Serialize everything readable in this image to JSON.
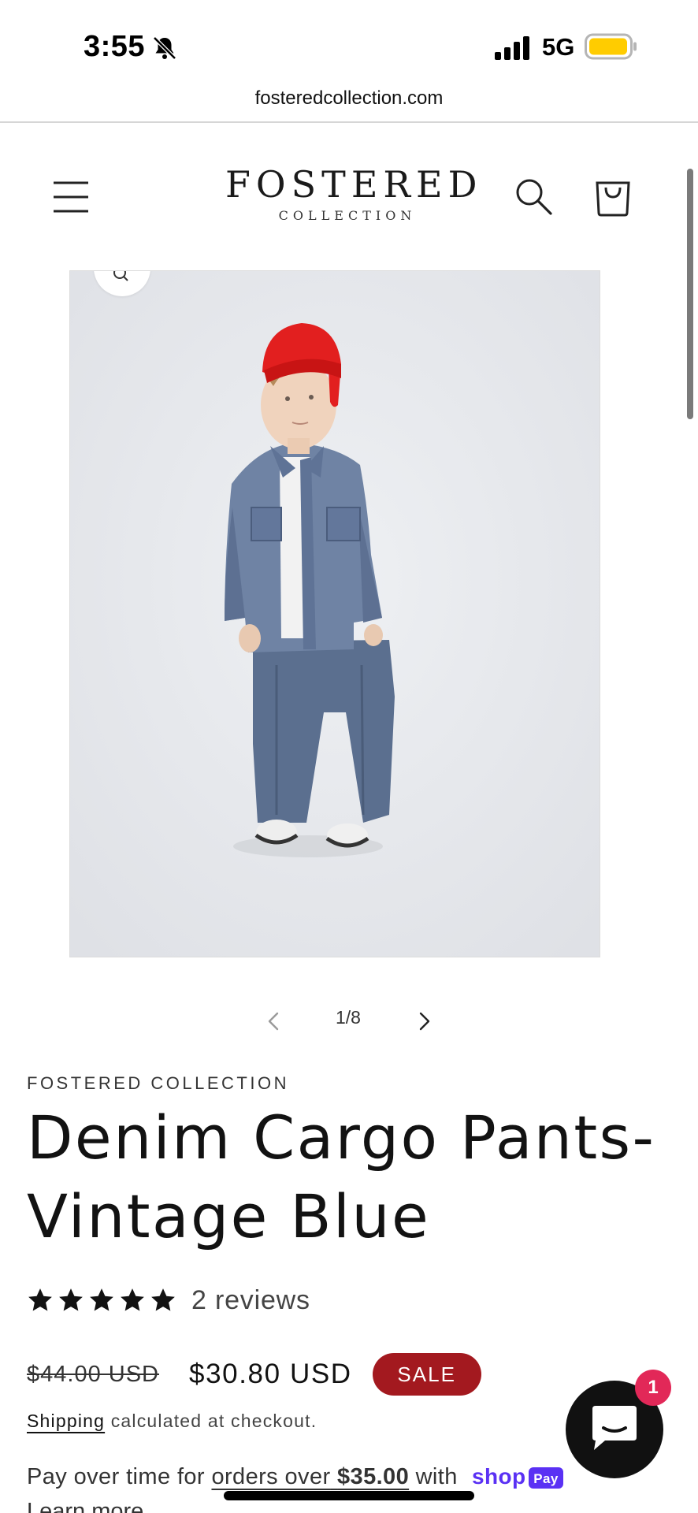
{
  "status_bar": {
    "time": "3:55",
    "network": "5G",
    "battery_color": "#ffcc00"
  },
  "browser": {
    "url": "fosteredcollection.com"
  },
  "header": {
    "logo_main": "FOSTERED",
    "logo_sub": "COLLECTION",
    "icons": [
      "menu-icon",
      "search-icon",
      "cart-icon"
    ]
  },
  "gallery": {
    "counter": "1/8",
    "icons": [
      "zoom-icon",
      "chevron-left-icon",
      "chevron-right-icon"
    ]
  },
  "product": {
    "vendor": "FOSTERED COLLECTION",
    "title": "Denim Cargo Pants- Vintage Blue",
    "rating_stars": 5,
    "reviews": "2 reviews",
    "compare_price": "$44.00 USD",
    "sale_price": "$30.80 USD",
    "badge": "SALE",
    "badge_color": "#a3191f",
    "shipping_link": "Shipping",
    "shipping_text": "calculated at checkout.",
    "installments_prefix": "Pay over time for",
    "installments_link": "orders over",
    "installments_amount": "$35.00",
    "installments_suffix": "with",
    "shop_logo_text": "shop",
    "shop_logo_pay": "Pay",
    "shop_color": "#5a31f4",
    "learn_more": "Learn more"
  },
  "chat": {
    "badge_count": "1",
    "badge_color": "#e22858"
  }
}
